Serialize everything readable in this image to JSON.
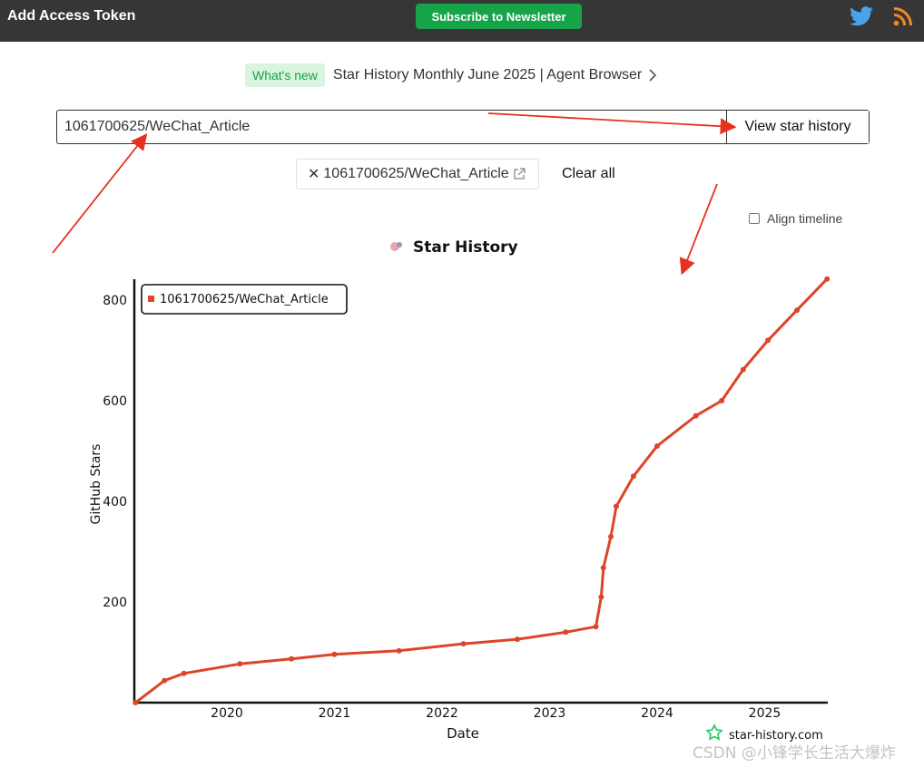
{
  "topbar": {
    "brand": "Add Access Token",
    "subscribe_label": "Subscribe to Newsletter",
    "icons": [
      "twitter-icon",
      "rss-icon"
    ],
    "accent_color": "#16a34a"
  },
  "announcement": {
    "badge": "What's new",
    "text": "Star History Monthly June 2025 | Agent Browser"
  },
  "search": {
    "value": "1061700625/WeChat_Article",
    "button_label": "View star history"
  },
  "chips": [
    {
      "label": "1061700625/WeChat_Article"
    }
  ],
  "clear_all_label": "Clear all",
  "align_timeline_label": "Align timeline",
  "chart_data": {
    "type": "line",
    "title": "Star History",
    "xlabel": "Date",
    "ylabel": "GitHub Stars",
    "x_ticks": [
      "2020",
      "2021",
      "2022",
      "2023",
      "2024",
      "2025"
    ],
    "y_ticks": [
      200,
      400,
      600,
      800
    ],
    "ylim": [
      0,
      840
    ],
    "legend": "top-left",
    "brand_label": "star-history.com",
    "series": [
      {
        "name": "1061700625/WeChat_Article",
        "color": "#dd4528",
        "points": [
          {
            "x": 2019.15,
            "y": 0
          },
          {
            "x": 2019.42,
            "y": 44
          },
          {
            "x": 2019.6,
            "y": 58
          },
          {
            "x": 2020.12,
            "y": 77
          },
          {
            "x": 2020.6,
            "y": 87
          },
          {
            "x": 2021.0,
            "y": 96
          },
          {
            "x": 2021.6,
            "y": 103
          },
          {
            "x": 2022.2,
            "y": 117
          },
          {
            "x": 2022.7,
            "y": 126
          },
          {
            "x": 2023.15,
            "y": 140
          },
          {
            "x": 2023.43,
            "y": 151
          },
          {
            "x": 2023.48,
            "y": 210
          },
          {
            "x": 2023.5,
            "y": 268
          },
          {
            "x": 2023.57,
            "y": 330
          },
          {
            "x": 2023.62,
            "y": 390
          },
          {
            "x": 2023.78,
            "y": 450
          },
          {
            "x": 2024.0,
            "y": 510
          },
          {
            "x": 2024.36,
            "y": 570
          },
          {
            "x": 2024.6,
            "y": 600
          },
          {
            "x": 2024.8,
            "y": 662
          },
          {
            "x": 2025.03,
            "y": 720
          },
          {
            "x": 2025.3,
            "y": 780
          },
          {
            "x": 2025.58,
            "y": 842
          }
        ]
      }
    ]
  },
  "watermark": "CSDN @小锋学长生活大爆炸"
}
